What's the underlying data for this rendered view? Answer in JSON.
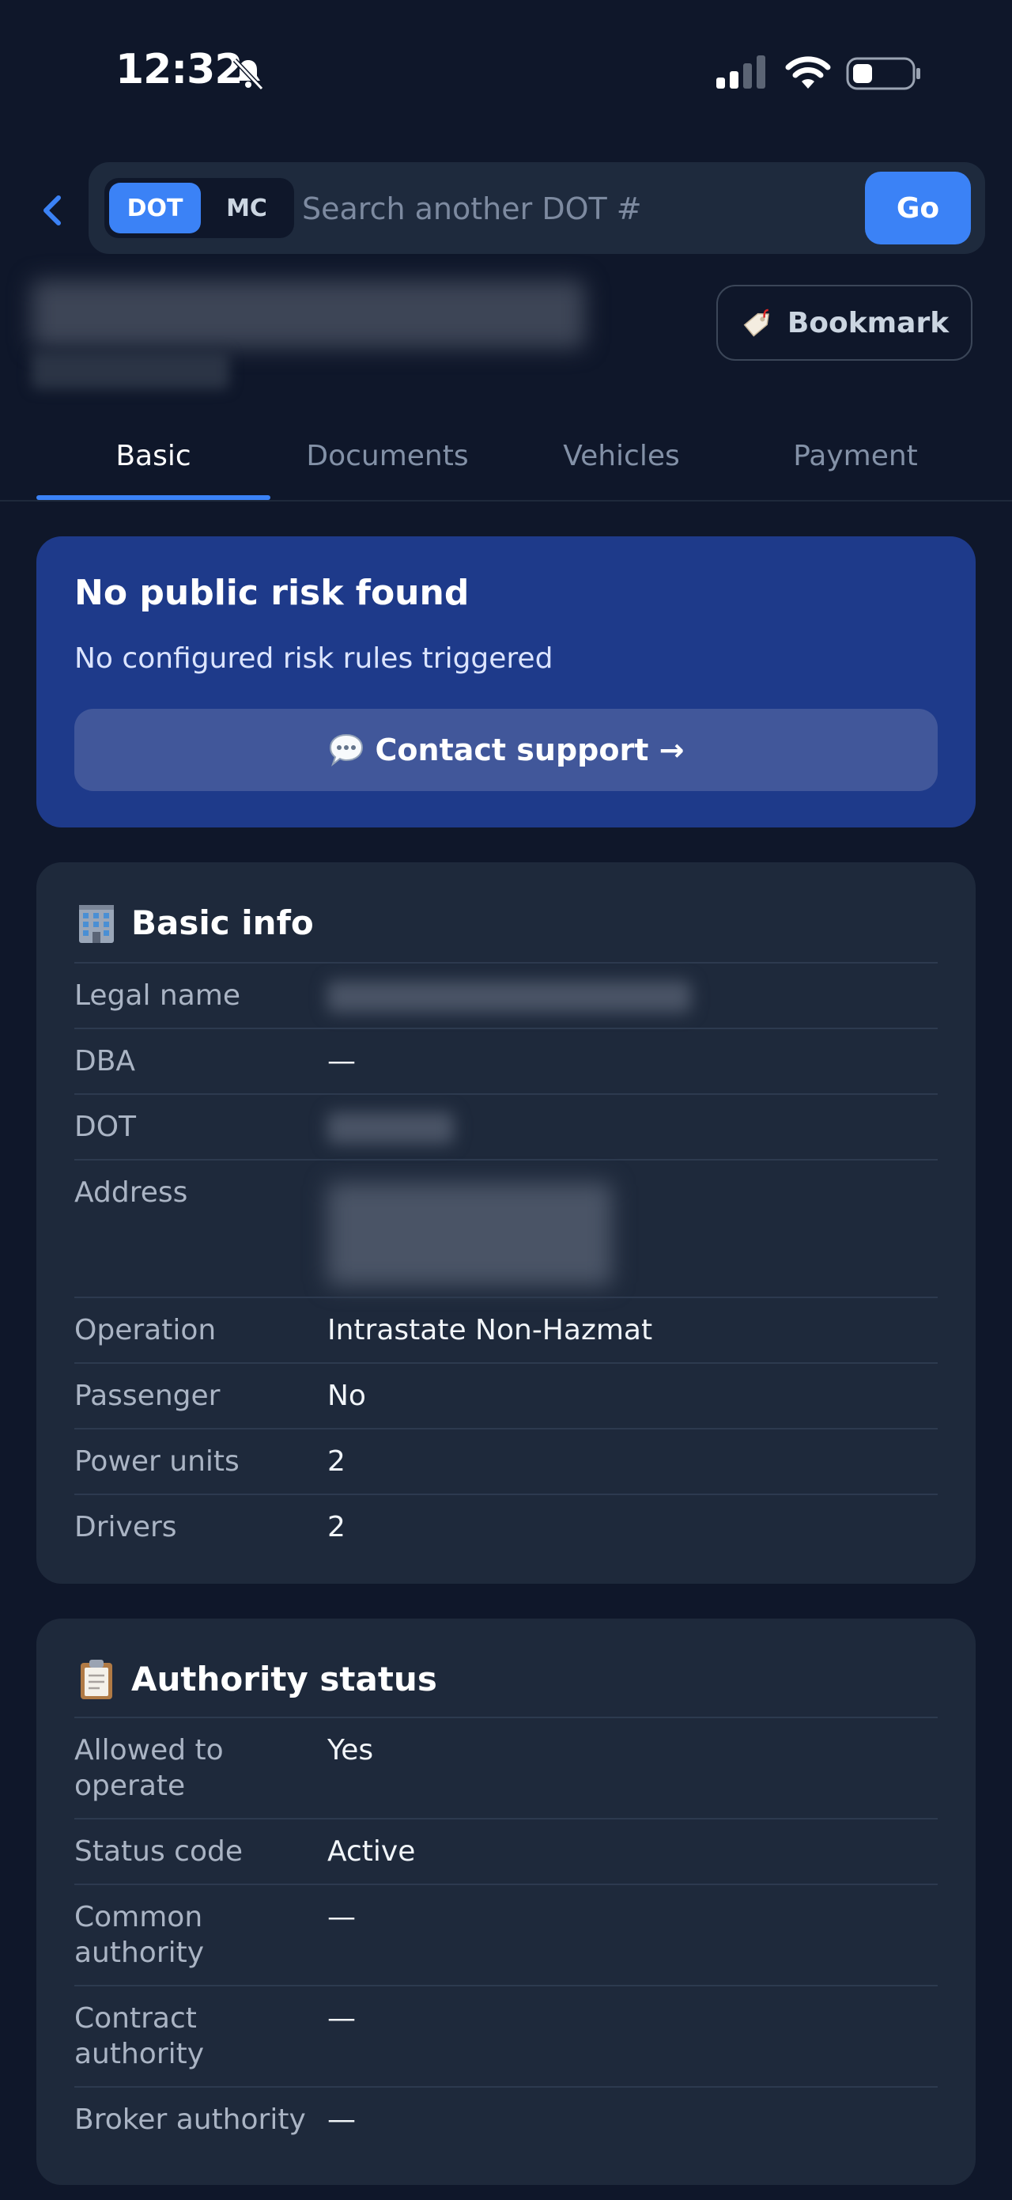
{
  "status_bar": {
    "time": "12:32"
  },
  "search": {
    "seg_dot": "DOT",
    "seg_mc": "MC",
    "placeholder": "Search another DOT #",
    "go_label": "Go"
  },
  "header": {
    "bookmark_label": "Bookmark"
  },
  "tabs": [
    "Basic",
    "Documents",
    "Vehicles",
    "Payment"
  ],
  "risk": {
    "title": "No public risk found",
    "subtitle": "No configured risk rules triggered",
    "contact_label": "Contact support →"
  },
  "basic_info": {
    "title": "Basic info",
    "rows": [
      {
        "label": "Legal name",
        "value": ""
      },
      {
        "label": "DBA",
        "value": "—"
      },
      {
        "label": "DOT",
        "value": ""
      },
      {
        "label": "Address",
        "value": ""
      },
      {
        "label": "Operation",
        "value": "Intrastate Non-Hazmat"
      },
      {
        "label": "Passenger",
        "value": "No"
      },
      {
        "label": "Power units",
        "value": "2"
      },
      {
        "label": "Drivers",
        "value": "2"
      }
    ]
  },
  "authority_status": {
    "title": "Authority status",
    "rows": [
      {
        "label": "Allowed to operate",
        "value": "Yes"
      },
      {
        "label": "Status code",
        "value": "Active"
      },
      {
        "label": "Common authority",
        "value": "—"
      },
      {
        "label": "Contract authority",
        "value": "—"
      },
      {
        "label": "Broker authority",
        "value": "—"
      }
    ]
  },
  "colors": {
    "accent": "#3b82f6",
    "risk_card": "#1e3a8a",
    "card": "#1e293b",
    "background": "#0f172a"
  }
}
